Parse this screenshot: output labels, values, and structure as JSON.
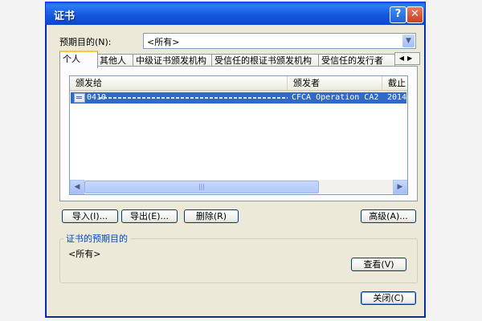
{
  "window": {
    "title": "证书",
    "help_glyph": "?",
    "close_glyph": "✕"
  },
  "purpose": {
    "label": "预期目的(N):",
    "value": "<所有>"
  },
  "tabs": [
    {
      "label": "个人",
      "active": true
    },
    {
      "label": "其他人"
    },
    {
      "label": "中级证书颁发机构"
    },
    {
      "label": "受信任的根证书颁发机构"
    },
    {
      "label": "受信任的发行者"
    }
  ],
  "tab_scroll": "◀▶",
  "list": {
    "columns": [
      "颁发给",
      "颁发者",
      "截止"
    ],
    "rows": [
      {
        "issued_to": "0410",
        "issuer": "CFCA Operation CA2",
        "expires": "2014",
        "selected": true
      }
    ],
    "scroll_left": "◀",
    "scroll_right": "▶",
    "thumb_grip": "|||"
  },
  "buttons": {
    "import": "导入(I)...",
    "export": "导出(E)...",
    "remove": "删除(R)",
    "advanced": "高级(A)...",
    "view": "查看(V)",
    "close": "关闭(C)"
  },
  "purposes_group": {
    "legend": "证书的预期目的",
    "text": "<所有>"
  },
  "colors": {
    "titlebar": "#0a5ee8",
    "selection": "#316ac5",
    "dialog_bg": "#ece9d8"
  }
}
